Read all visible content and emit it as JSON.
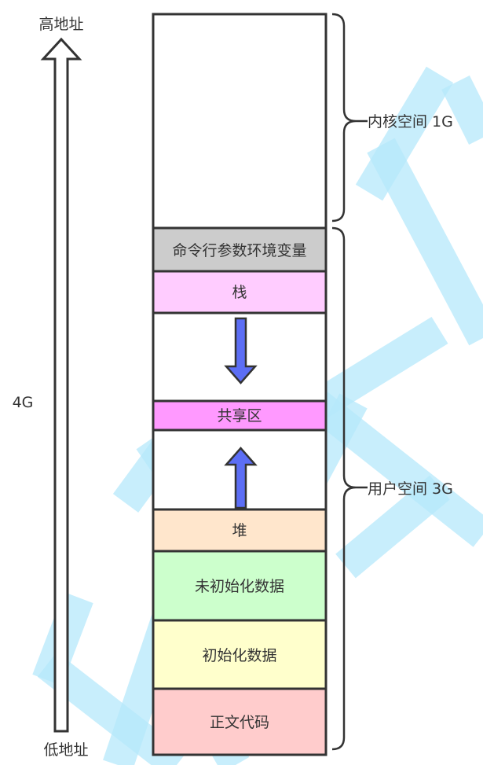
{
  "address_axis": {
    "top_label": "高地址",
    "bottom_label": "低地址",
    "size_label": "4G"
  },
  "segments": [
    {
      "label": "",
      "color": "#ffffff"
    },
    {
      "label": "命令行参数环境变量",
      "color": "#cccccc"
    },
    {
      "label": "栈",
      "color": "#ffccff"
    },
    {
      "label": "",
      "color": "#ffffff"
    },
    {
      "label": "共享区",
      "color": "#ff99ff"
    },
    {
      "label": "",
      "color": "#ffffff"
    },
    {
      "label": "堆",
      "color": "#ffe6cc"
    },
    {
      "label": "未初始化数据",
      "color": "#ccffcc"
    },
    {
      "label": "初始化数据",
      "color": "#ffffcc"
    },
    {
      "label": "正文代码",
      "color": "#ffcccc"
    }
  ],
  "braces": {
    "kernel_label": "内核空间 1G",
    "user_label": "用户空间 3G"
  },
  "colors": {
    "arrow_fill": "#5c6ef5",
    "stroke": "#333333"
  }
}
